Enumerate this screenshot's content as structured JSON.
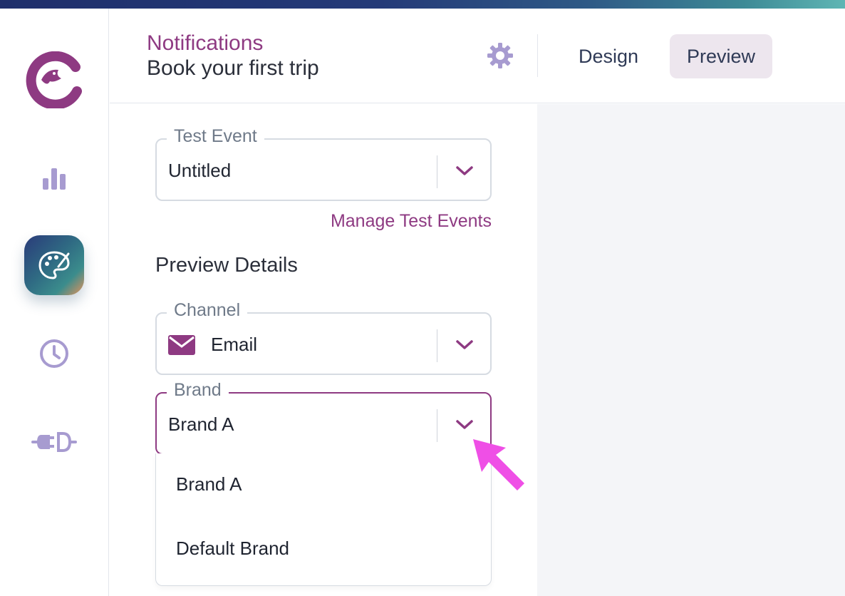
{
  "app": {
    "accent_color": "#8e3a82",
    "nav_icon_color": "#a79bd0",
    "pointer_color": "#ef4fe6"
  },
  "rail": {
    "items": [
      {
        "name": "logo",
        "icon": "courier-bird-logo"
      },
      {
        "name": "analytics",
        "icon": "bar-chart-icon"
      },
      {
        "name": "designer",
        "icon": "palette-icon",
        "active": true
      },
      {
        "name": "history",
        "icon": "clock-icon"
      },
      {
        "name": "integrations",
        "icon": "plug-icon"
      }
    ]
  },
  "header": {
    "section_title": "Notifications",
    "page_title": "Book your first trip",
    "settings_icon": "gear-icon",
    "tabs": [
      {
        "label": "Design",
        "active": false
      },
      {
        "label": "Preview",
        "active": true
      }
    ]
  },
  "panel": {
    "test_event": {
      "label": "Test Event",
      "value": "Untitled"
    },
    "manage_link": "Manage Test Events",
    "section_heading": "Preview Details",
    "channel": {
      "label": "Channel",
      "value": "Email",
      "icon": "mail-icon"
    },
    "brand": {
      "label": "Brand",
      "value": "Brand A",
      "options": [
        "Brand A",
        "Default Brand"
      ]
    }
  }
}
